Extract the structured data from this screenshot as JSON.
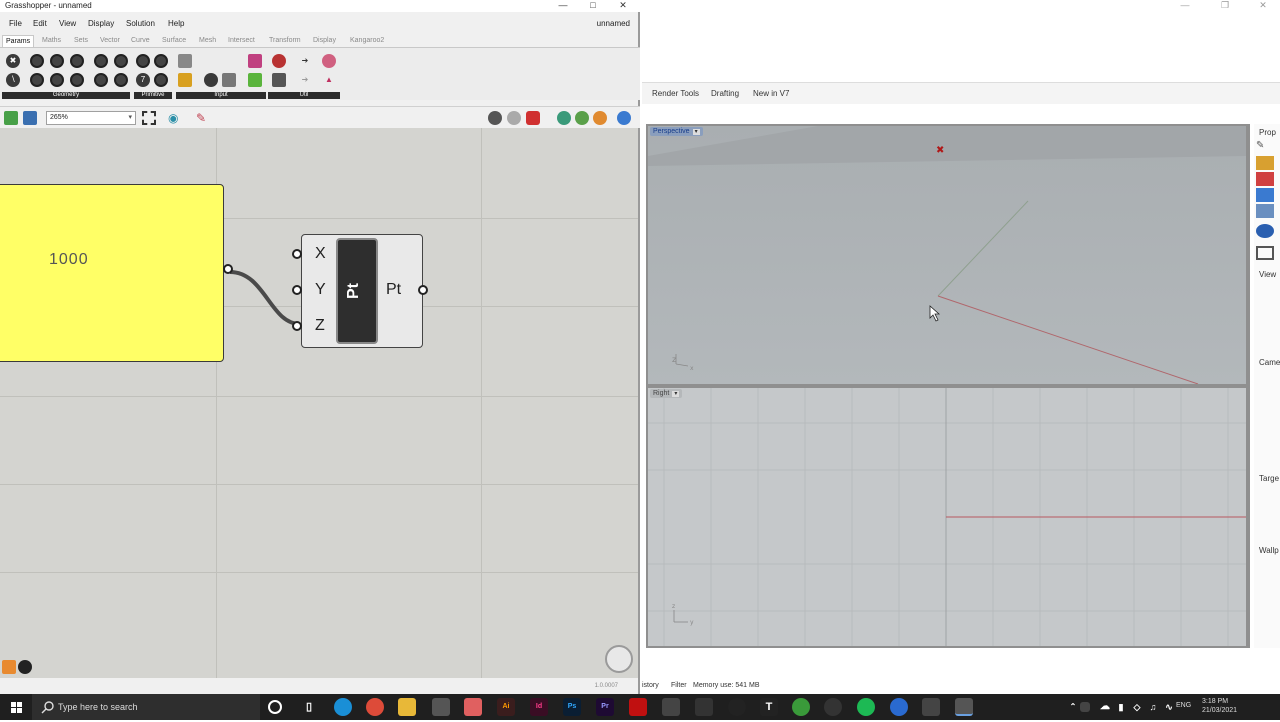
{
  "grasshopper": {
    "window_title": "Grasshopper - unnamed",
    "doc_name": "unnamed",
    "menu": [
      "File",
      "Edit",
      "View",
      "Display",
      "Solution",
      "Help"
    ],
    "tabs": [
      "Params",
      "Maths",
      "Sets",
      "Vector",
      "Curve",
      "Surface",
      "Mesh",
      "Intersect",
      "Transform",
      "Display",
      "Kangaroo2"
    ],
    "active_tab": "Params",
    "ribbon_groups": [
      "Geometry",
      "Primitive",
      "Input",
      "Util"
    ],
    "zoom": "265%",
    "slider_value": "1000",
    "component": {
      "core_label": "Pt",
      "inputs": [
        "X",
        "Y",
        "Z"
      ],
      "output": "Pt"
    },
    "version": "1.0.0007"
  },
  "rhino": {
    "tabs": [
      "Render Tools",
      "Drafting",
      "New in V7"
    ],
    "viewports": {
      "top_label": "Perspective",
      "bottom_label": "Right"
    },
    "panel_labels": [
      "Prop",
      "View",
      "Came",
      "Targe",
      "Wallp"
    ],
    "status": {
      "history": "istory",
      "filter": "Filter",
      "memory": "Memory use: 541 MB"
    }
  },
  "taskbar": {
    "search_placeholder": "Type here to search",
    "language": "ENG",
    "time": "3:18 PM",
    "date": "21/03/2021"
  }
}
